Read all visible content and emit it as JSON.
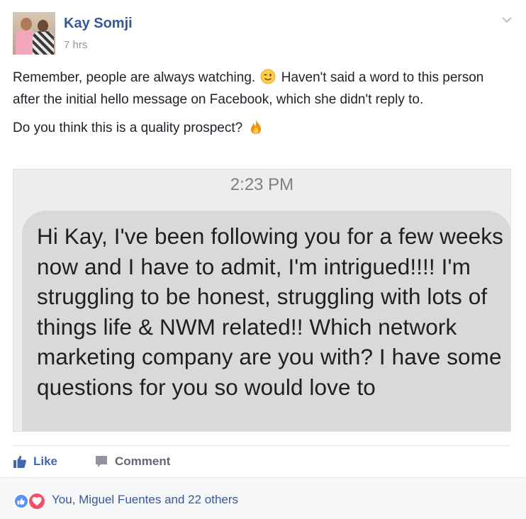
{
  "post": {
    "author": "Kay Somji",
    "time": "7 hrs",
    "paragraph_1": "Remember, people are always watching.",
    "paragraph_1_rest": "Haven't said a word to this person after the initial hello message on Facebook, which she didn't reply to.",
    "paragraph_2": "Do you think this is a quality prospect?",
    "icons": {
      "menu": "chevron-down-icon",
      "emoji_1": "wink-emoji",
      "emoji_2": "fire-emoji"
    }
  },
  "attached_image": {
    "time": "2:23 PM",
    "message": "Hi Kay, I've been following you for a few weeks now and I have to admit, I'm intrigued!!!! I'm struggling to be honest, struggling with lots of things life & NWM related!! Which network marketing company are you with? I have some questions for you so would love to"
  },
  "actions": {
    "like_label": "Like",
    "comment_label": "Comment"
  },
  "reactions": {
    "summary": "You, Miguel Fuentes and 22 others",
    "types": [
      "like-reaction-icon",
      "love-reaction-icon"
    ]
  },
  "colors": {
    "link_blue": "#365899",
    "like_blue": "#4267b2",
    "meta_gray": "#90949c",
    "love_red": "#f25268",
    "like_reaction": "#5890ff"
  }
}
